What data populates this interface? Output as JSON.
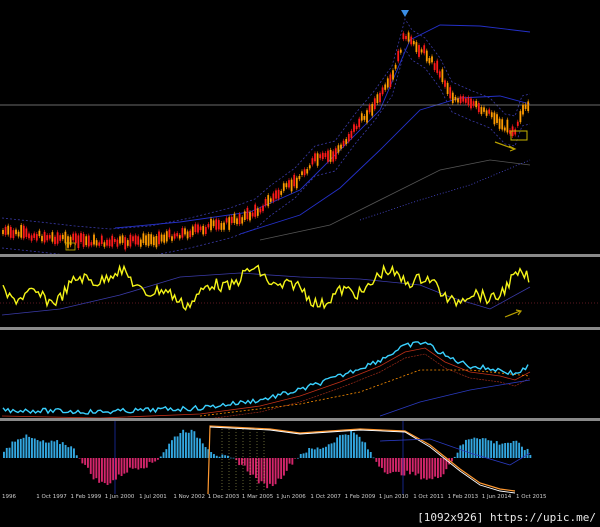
{
  "x_axis": {
    "labels": [
      "1996",
      "1 Oct 1997",
      "1 Feb 1999",
      "1 Jun 2000",
      "1 Jul 2001",
      "1 Nov 2002",
      "1 Dec 2003",
      "1 Mar 2005",
      "1 Jun 2006",
      "1 Oct 2007",
      "1 Feb 2009",
      "1 Jun 2010",
      "1 Oct 2011",
      "1 Feb 2013",
      "1 Jun 2014",
      "1 Oct 2015"
    ]
  },
  "footer": {
    "credit": "[1092x926] https://upic.me/"
  },
  "colors": {
    "bull_candle": "#ff9c00",
    "bear_candle": "#ff1a1a",
    "oscillator": "#f5f518",
    "ma_line": "#3ad1ff",
    "hist_up": "#33a7e0",
    "hist_down": "#d4266b",
    "envelope": "#2430c8",
    "separator": "#8a8a8a",
    "marker_arrow": "#3a8ee6"
  },
  "icons": [
    "down-arrow-marker-icon",
    "green-arrow-annotation-icon"
  ]
}
